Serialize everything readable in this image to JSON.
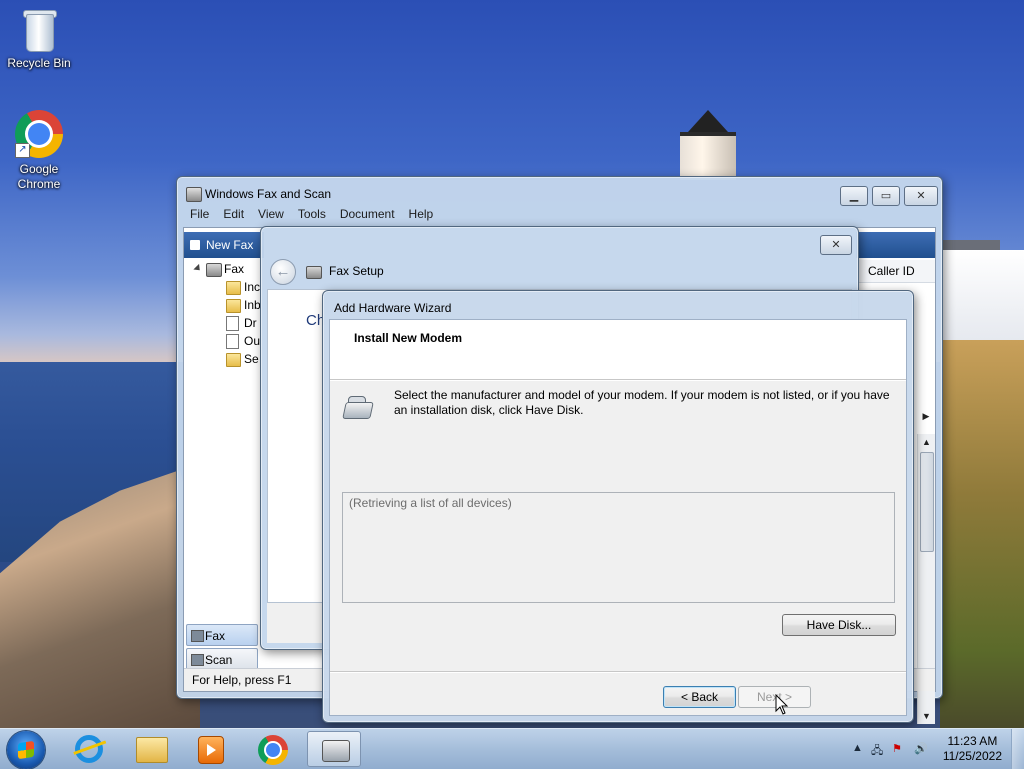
{
  "desktop": {
    "icons": [
      {
        "label": "Recycle Bin",
        "icon": "recycle-bin-icon"
      },
      {
        "label": "Google\nChrome",
        "icon": "chrome-icon"
      }
    ]
  },
  "main_window": {
    "title": "Windows Fax and Scan",
    "menu": [
      "File",
      "Edit",
      "View",
      "Tools",
      "Document",
      "Help"
    ],
    "toolbar": {
      "new_fax": "New Fax"
    },
    "tree": {
      "root": "Fax",
      "children": [
        "Inc",
        "Inb",
        "Dr",
        "Ou",
        "Se"
      ]
    },
    "column_header": "Caller ID",
    "nav": {
      "fax": "Fax",
      "scan": "Scan"
    },
    "status": "For Help, press F1"
  },
  "fax_setup": {
    "title": "Fax Setup",
    "heading_fragment": "Ch"
  },
  "wizard": {
    "title": "Add Hardware Wizard",
    "header": "Install New Modem",
    "instructions": "Select the manufacturer and model of your modem. If your modem is not listed, or if you have an installation disk, click Have Disk.",
    "list_placeholder": "(Retrieving a list of all devices)",
    "have_disk": "Have Disk...",
    "back": "< Back",
    "next": "Next >"
  },
  "taskbar": {
    "items": [
      "internet-explorer-icon",
      "file-explorer-icon",
      "media-player-icon",
      "chrome-icon",
      "fax-and-scan-icon"
    ],
    "active_item": "fax-and-scan-icon",
    "clock_time": "11:23 AM",
    "clock_date": "11/25/2022"
  },
  "colors": {
    "accent": "#21508f",
    "title_glass": "#c4d6ec"
  }
}
